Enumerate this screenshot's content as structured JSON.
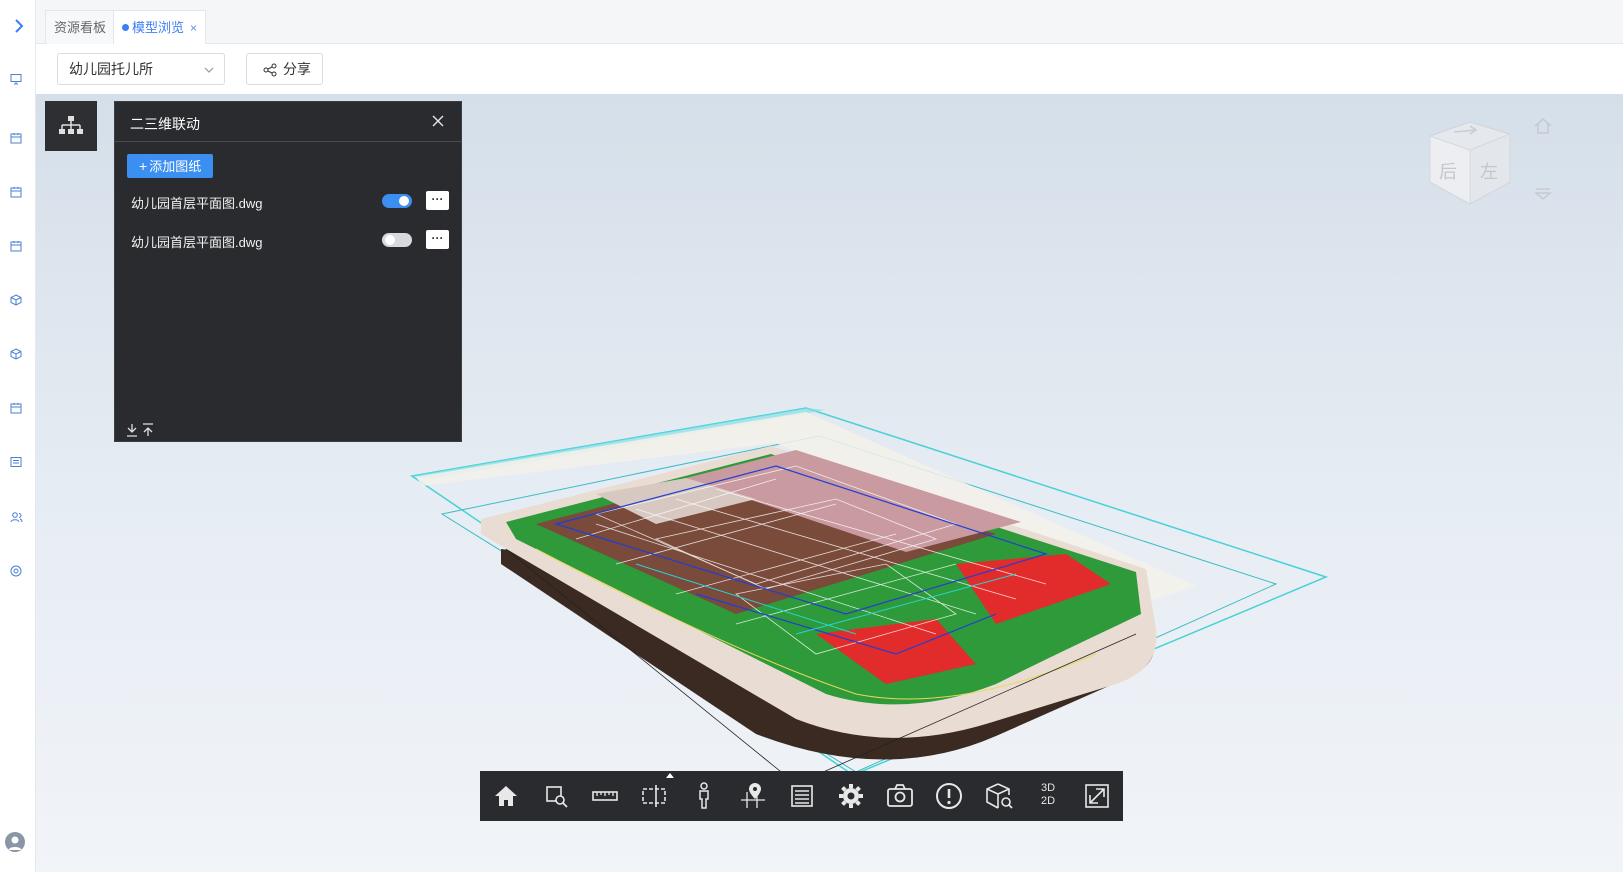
{
  "tabs": [
    {
      "label": "资源看板",
      "active": false
    },
    {
      "label": "模型浏览",
      "active": true,
      "close_glyph": "×"
    }
  ],
  "toolbar": {
    "project_select_value": "幼儿园托儿所",
    "share_label": "分享"
  },
  "panel": {
    "title": "二三维联动",
    "add_button_label": "添加图纸",
    "files": [
      {
        "name": "幼儿园首层平面图.dwg",
        "enabled": true,
        "more_label": "···"
      },
      {
        "name": "幼儿园首层平面图.dwg",
        "enabled": false,
        "more_label": "···"
      }
    ]
  },
  "viewcube": {
    "face_back": "后",
    "face_left": "左"
  },
  "bottom_toolbar": {
    "tools": [
      "home-icon",
      "zoom-box-icon",
      "measure-ruler-icon",
      "section-box-icon",
      "first-person-icon",
      "location-pin-icon",
      "property-list-icon",
      "settings-gear-icon",
      "screenshot-camera-icon",
      "warning-icon",
      "model-inspect-icon",
      "3d-2d-toggle-icon",
      "fullscreen-icon"
    ],
    "mode_3d": "3D",
    "mode_2d": "2D"
  },
  "colors": {
    "accent": "#3b8ff0",
    "panel_bg": "#2a2b2e",
    "viewport_top": "#d5dfe9"
  }
}
